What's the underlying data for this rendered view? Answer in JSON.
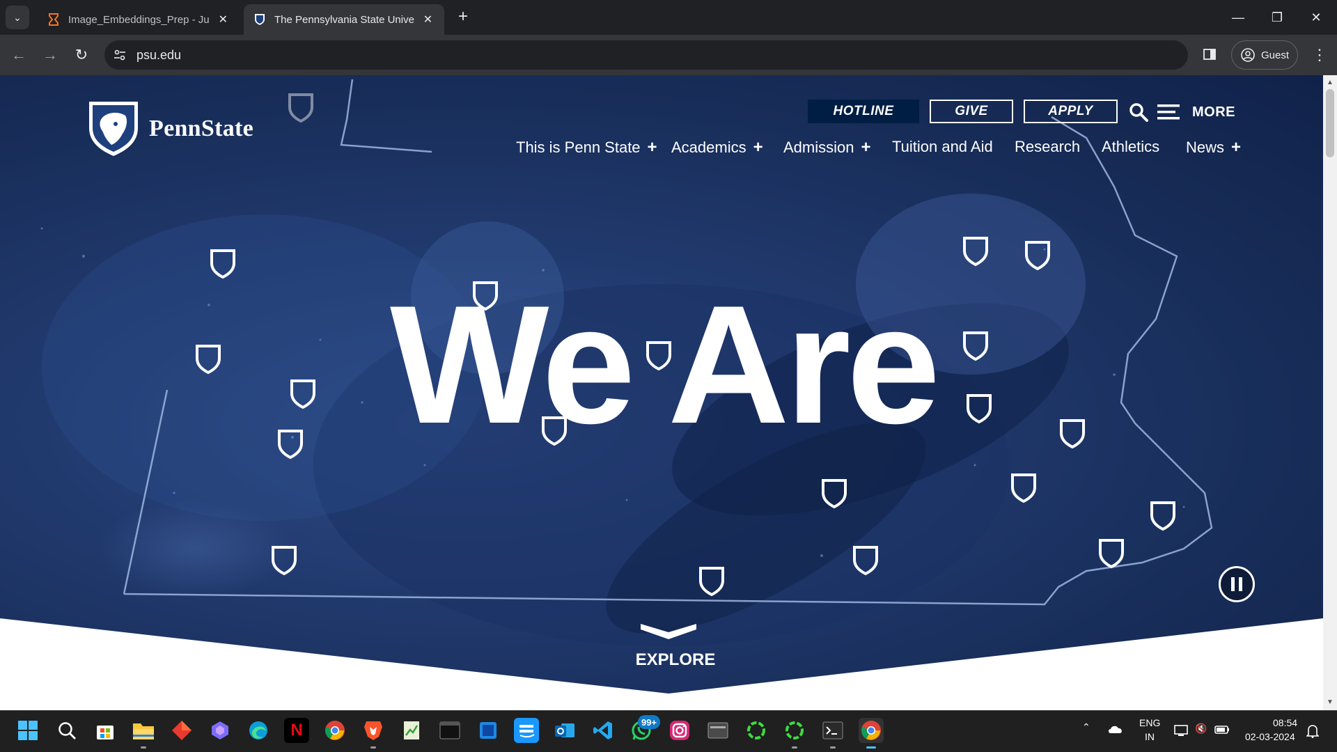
{
  "browser": {
    "tabs": [
      {
        "title": "Image_Embeddings_Prep - Jupy",
        "icon": "hourglass-icon",
        "active": false
      },
      {
        "title": "The Pennsylvania State Universit",
        "icon": "psu-shield-icon",
        "active": true
      }
    ],
    "url": "psu.edu",
    "profile_label": "Guest",
    "accent": "#35363a"
  },
  "site": {
    "logo_text": "PennState",
    "utility_nav": {
      "hotline": "HOTLINE",
      "give": "GIVE",
      "apply": "APPLY",
      "more": "MORE"
    },
    "main_nav": [
      {
        "label": "This is Penn State",
        "expandable": true
      },
      {
        "label": "Academics",
        "expandable": true
      },
      {
        "label": "Admission",
        "expandable": true
      },
      {
        "label": "Tuition and Aid",
        "expandable": false
      },
      {
        "label": "Research",
        "expandable": false
      },
      {
        "label": "Athletics",
        "expandable": false
      },
      {
        "label": "News",
        "expandable": true
      }
    ],
    "plus_symbol": "+",
    "hero_title": "We Are",
    "explore_label": "EXPLORE",
    "colors": {
      "navy": "#001e44",
      "hero_blue": "#1e3a70"
    }
  },
  "taskbar": {
    "apps": [
      "windows-start-icon",
      "search-icon",
      "store-icon",
      "file-explorer-icon",
      "app-red-diamond-icon",
      "app-copilot-icon",
      "edge-icon",
      "netflix-icon",
      "chrome-icon",
      "brave-icon",
      "app-sheet-icon",
      "terminal-icon",
      "app-window-icon",
      "prime-video-icon",
      "outlook-icon",
      "vscode-icon",
      "whatsapp-icon",
      "instagram-icon",
      "app-gray-icon",
      "app-green-ring-icon",
      "app-green-ring-2-icon",
      "terminal-2-icon",
      "chrome-active-icon"
    ],
    "netflix_letter": "N",
    "whatsapp_badge": "99+",
    "lang_line1": "ENG",
    "lang_line2": "IN",
    "time": "08:54",
    "date": "02-03-2024"
  }
}
